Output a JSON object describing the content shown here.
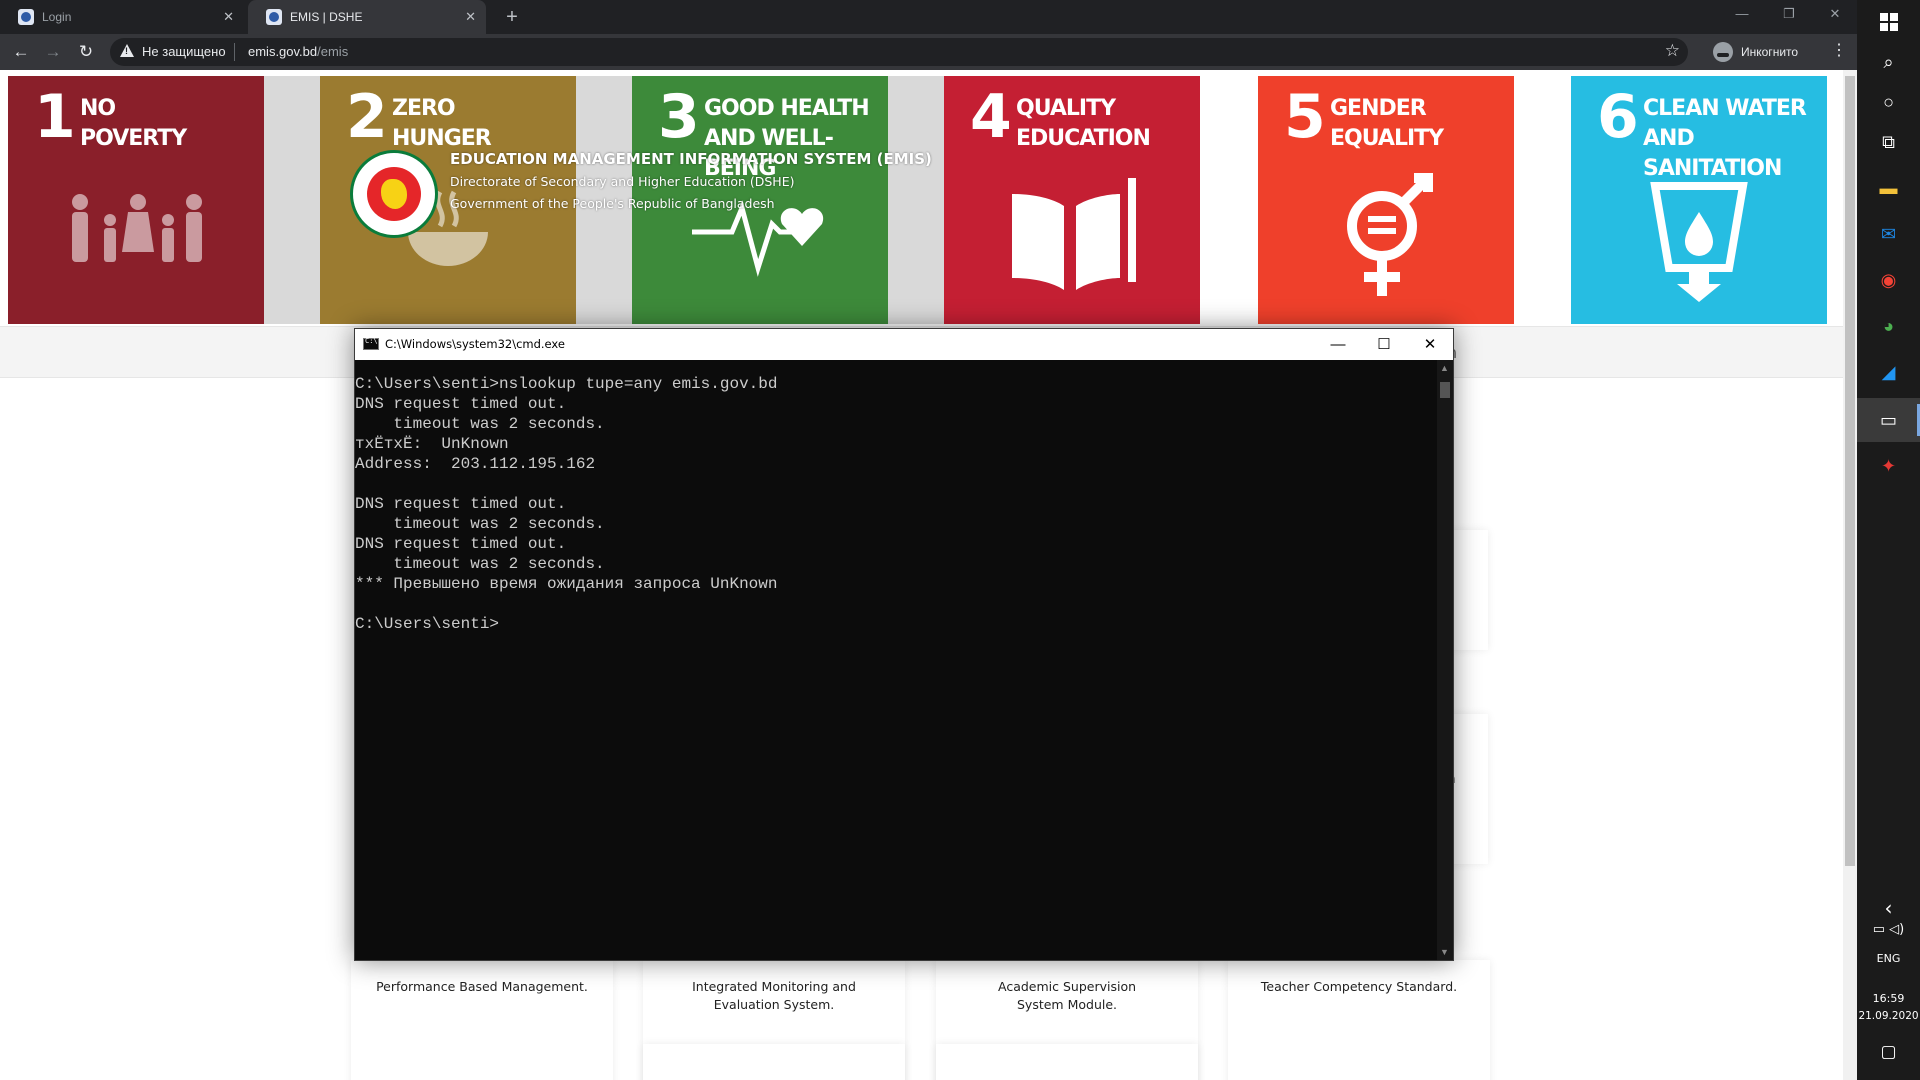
{
  "browser": {
    "tabs": [
      {
        "title": "Login",
        "active": false
      },
      {
        "title": "EMIS | DSHE",
        "active": true
      }
    ],
    "new_tab": "+",
    "security_label": "Не защищено",
    "url_host": "emis.gov.bd",
    "url_path": "/emis",
    "incognito_label": "Инкогнито",
    "window_controls": {
      "minimize": "—",
      "restore": "❐",
      "close": "✕"
    }
  },
  "site": {
    "sdg_tiles": [
      {
        "number": "1",
        "label": "No Poverty",
        "color": "#8a1f2a"
      },
      {
        "number": "2",
        "label": "Zero Hunger",
        "color": "#9b7b30"
      },
      {
        "number": "3",
        "label": "Good Health And Well-Being",
        "color": "#3d8a3a"
      },
      {
        "number": "4",
        "label": "Quality Education",
        "color": "#c41f33"
      },
      {
        "number": "5",
        "label": "Gender Equality",
        "color": "#ef402b"
      },
      {
        "number": "6",
        "label": "Clean Water And Sanitation",
        "color": "#26bde2"
      }
    ],
    "title": "EDUCATION MANAGEMENT INFORMATION SYSTEM (EMIS)",
    "subtitle1": "Directorate of Secondary and Higher Education (DSHE)",
    "subtitle2": "Government of the People's Republic of Bangladesh",
    "nav_fragment": "n",
    "side_fragment": "n",
    "cards": [
      "Performance Based Management.",
      "Integrated Monitoring and Evaluation System.",
      "Academic Supervision System Module.",
      "Teacher Competency Standard."
    ]
  },
  "cmd": {
    "title": "C:\\Windows\\system32\\cmd.exe",
    "controls": {
      "minimize": "—",
      "maximize": "☐",
      "close": "✕"
    },
    "lines": [
      "C:\\Users\\senti>nslookup tupe=any emis.gov.bd",
      "DNS request timed out.",
      "    timeout was 2 seconds.",
      "тхЁтхЁ:  UnKnown",
      "Address:  203.112.195.162",
      "",
      "DNS request timed out.",
      "    timeout was 2 seconds.",
      "DNS request timed out.",
      "    timeout was 2 seconds.",
      "*** Превышено время ожидания запроса UnKnown",
      "",
      "C:\\Users\\senti>"
    ]
  },
  "taskbar": {
    "apps": [
      {
        "name": "search",
        "glyph": "⌕"
      },
      {
        "name": "cortana",
        "glyph": "○"
      },
      {
        "name": "task-view",
        "glyph": "⧉"
      },
      {
        "name": "file-explorer",
        "glyph": "▬"
      },
      {
        "name": "mail",
        "glyph": "✉"
      },
      {
        "name": "yandex",
        "glyph": "◉"
      },
      {
        "name": "chrome",
        "glyph": "◕"
      },
      {
        "name": "edge",
        "glyph": "◢"
      },
      {
        "name": "cmd",
        "glyph": "▭"
      },
      {
        "name": "app",
        "glyph": "✦"
      }
    ],
    "tray_chevron": "‹",
    "language": "ENG",
    "time": "16:59",
    "date": "21.09.2020",
    "notifications": "▢"
  }
}
